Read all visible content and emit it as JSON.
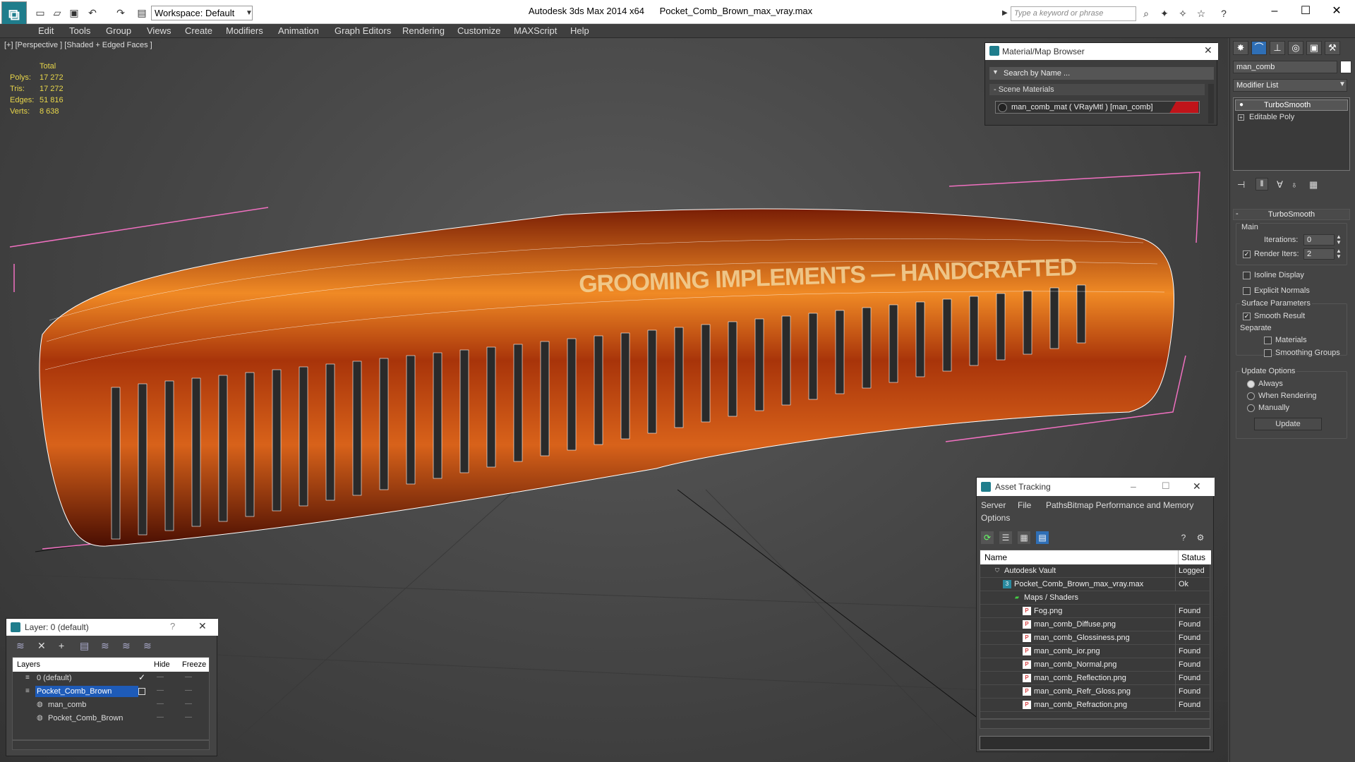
{
  "titlebar": {
    "workspace": "Workspace: Default",
    "app_title": "Autodesk 3ds Max  2014 x64",
    "file_title": "Pocket_Comb_Brown_max_vray.max",
    "search_placeholder": "Type a keyword or phrase"
  },
  "menu": [
    "Edit",
    "Tools",
    "Group",
    "Views",
    "Create",
    "Modifiers",
    "Animation",
    "Graph Editors",
    "Rendering",
    "Customize",
    "MAXScript",
    "Help"
  ],
  "viewport": {
    "label": "[+] [Perspective ] [Shaded + Edged Faces ]",
    "stats": {
      "header": "Total",
      "polys_label": "Polys:",
      "polys": "17 272",
      "tris_label": "Tris:",
      "tris": "17 272",
      "edges_label": "Edges:",
      "edges": "51 816",
      "verts_label": "Verts:",
      "verts": "8 638"
    },
    "comb_text": "GROOMING IMPLEMENTS — HANDCRAFTED"
  },
  "material_browser": {
    "title": "Material/Map Browser",
    "search": "Search by Name ...",
    "section": "- Scene Materials",
    "material": "man_comb_mat  ( VRayMtl )  [man_comb]"
  },
  "command_panel": {
    "object_name": "man_comb",
    "modifier_list": "Modifier List",
    "stack": [
      "TurboSmooth",
      "Editable Poly"
    ],
    "rollout_title": "TurboSmooth",
    "main_label": "Main",
    "iterations_label": "Iterations:",
    "iterations": "0",
    "render_iters_label": "Render Iters:",
    "render_iters": "2",
    "isoline": "Isoline Display",
    "explicit_normals": "Explicit Normals",
    "surface_params": "Surface Parameters",
    "smooth_result": "Smooth Result",
    "separate": "Separate",
    "materials": "Materials",
    "smoothing_groups": "Smoothing Groups",
    "update_options": "Update Options",
    "always": "Always",
    "when_rendering": "When Rendering",
    "manually": "Manually",
    "update_button": "Update"
  },
  "asset_tracking": {
    "title": "Asset Tracking",
    "menu": [
      "Server",
      "File",
      "Paths",
      "Bitmap Performance and Memory",
      "Options"
    ],
    "col_name": "Name",
    "col_status": "Status",
    "rows": [
      {
        "name": "Autodesk Vault",
        "status": "Logged",
        "indent": 1,
        "icon": "vault-icon"
      },
      {
        "name": "Pocket_Comb_Brown_max_vray.max",
        "status": "Ok",
        "indent": 2,
        "icon": "max-file-icon"
      },
      {
        "name": "Maps / Shaders",
        "status": "",
        "indent": 3,
        "icon": "maps-icon"
      },
      {
        "name": "Fog.png",
        "status": "Found",
        "indent": 4,
        "icon": "png-icon"
      },
      {
        "name": "man_comb_Diffuse.png",
        "status": "Found",
        "indent": 4,
        "icon": "png-icon"
      },
      {
        "name": "man_comb_Glossiness.png",
        "status": "Found",
        "indent": 4,
        "icon": "png-icon"
      },
      {
        "name": "man_comb_ior.png",
        "status": "Found",
        "indent": 4,
        "icon": "png-icon"
      },
      {
        "name": "man_comb_Normal.png",
        "status": "Found",
        "indent": 4,
        "icon": "png-icon"
      },
      {
        "name": "man_comb_Reflection.png",
        "status": "Found",
        "indent": 4,
        "icon": "png-icon"
      },
      {
        "name": "man_comb_Refr_Gloss.png",
        "status": "Found",
        "indent": 4,
        "icon": "png-icon"
      },
      {
        "name": "man_comb_Refraction.png",
        "status": "Found",
        "indent": 4,
        "icon": "png-icon"
      }
    ]
  },
  "layers": {
    "title": "Layer: 0 (default)",
    "help": "?",
    "col_layers": "Layers",
    "col_hide": "Hide",
    "col_freeze": "Freeze",
    "rows": [
      {
        "name": "0 (default)",
        "indent": 1,
        "selected": false
      },
      {
        "name": "Pocket_Comb_Brown",
        "indent": 1,
        "selected": true
      },
      {
        "name": "man_comb",
        "indent": 2,
        "selected": false
      },
      {
        "name": "Pocket_Comb_Brown",
        "indent": 2,
        "selected": false
      }
    ]
  },
  "colors": {
    "accent": "#1f7d8c",
    "selection": "#1e5bb8",
    "stats": "#e8d64a",
    "comb": "#c8520e"
  }
}
